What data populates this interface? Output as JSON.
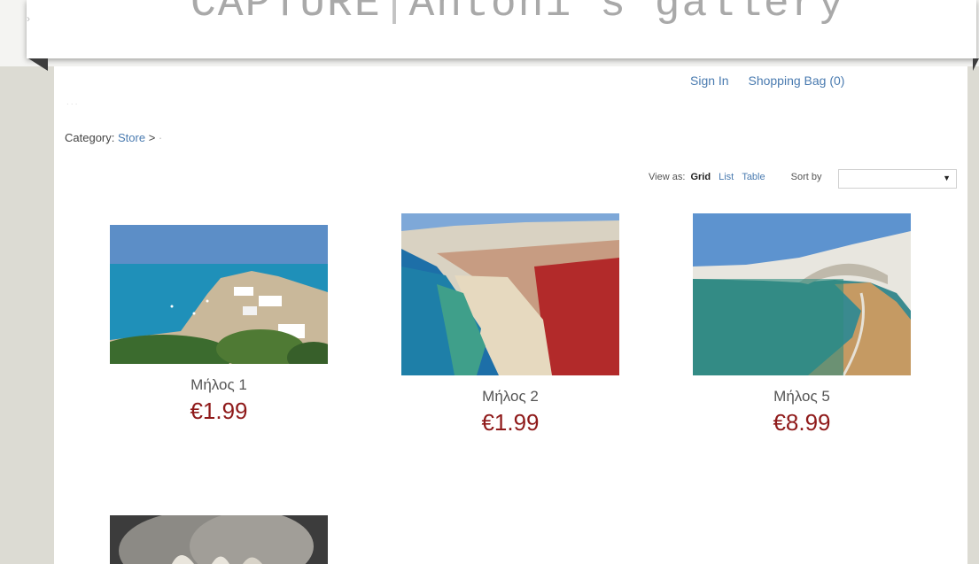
{
  "header": {
    "title_left": "CAPTURE",
    "title_sep": "|",
    "title_right": "Antoni's gallery"
  },
  "nav": {
    "sign_in": "Sign In",
    "shopping_bag": "Shopping Bag (0)"
  },
  "breadcrumb": {
    "prefix": "Category:",
    "store": "Store",
    "separator": ">"
  },
  "view": {
    "label": "View as:",
    "grid": "Grid",
    "list": "List",
    "table": "Table",
    "sort_label": "Sort by",
    "sort_value": ""
  },
  "products": [
    {
      "name": "Μήλος 1",
      "price": "€1.99"
    },
    {
      "name": "Μήλος 2",
      "price": "€1.99"
    },
    {
      "name": "Μήλος 5",
      "price": "€8.99"
    },
    {
      "name": "",
      "price": ""
    }
  ]
}
